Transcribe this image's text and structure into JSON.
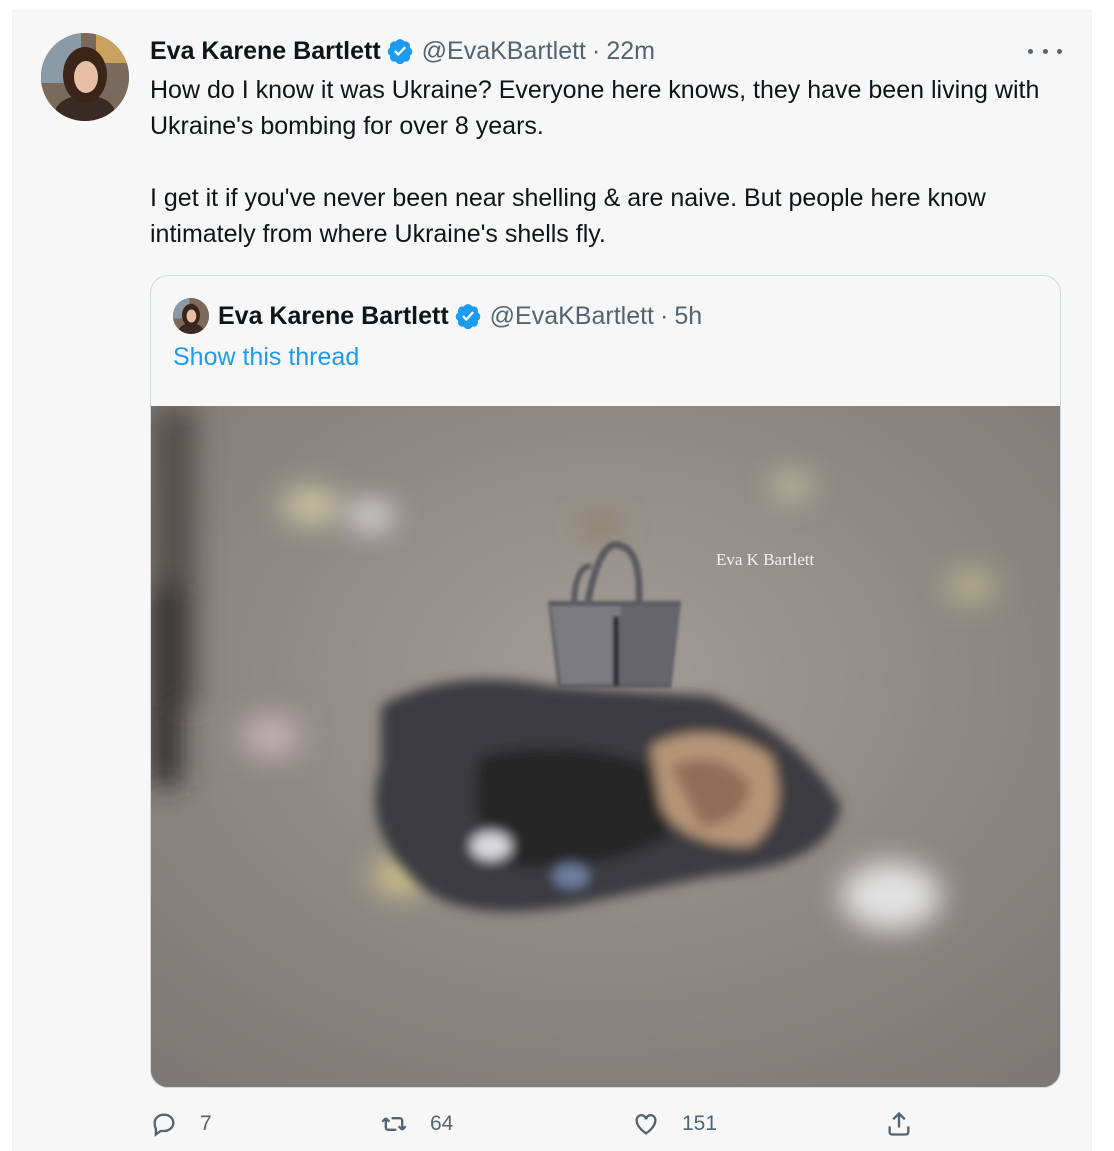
{
  "tweet": {
    "author_name": "Eva Karene Bartlett",
    "handle": "@EvaKBartlett",
    "separator": "·",
    "time": "22m",
    "text": "How do I know it was Ukraine? Everyone here knows, they have been living with Ukraine's bombing for over 8 years.\n\nI get it if you've never been near shelling & are naive. But people here know intimately from where Ukraine's shells fly."
  },
  "quoted_tweet": {
    "author_name": "Eva Karene Bartlett",
    "handle": "@EvaKBartlett",
    "separator": "·",
    "time": "5h",
    "show_thread": "Show this thread",
    "image_watermark": "Eva K Bartlett"
  },
  "actions": {
    "reply_count": "7",
    "retweet_count": "64",
    "like_count": "151"
  },
  "colors": {
    "accent": "#1d9bf0",
    "secondary_text": "#536471",
    "verified": "#1d9bf0"
  },
  "icons": [
    "verified-icon",
    "more-icon",
    "reply-icon",
    "retweet-icon",
    "like-icon",
    "share-icon"
  ]
}
